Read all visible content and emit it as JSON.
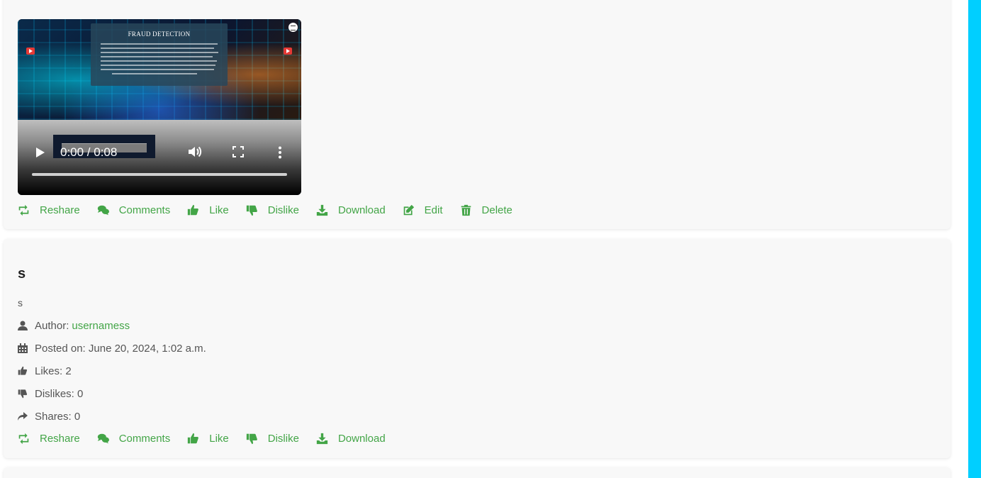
{
  "posts": [
    {
      "video": {
        "thumbnail_title": "FRAUD DETECTION",
        "time": "0:00 / 0:08",
        "played_fraction": 0
      },
      "actions": [
        "Reshare",
        "Comments",
        "Like",
        "Dislike",
        "Download",
        "Edit",
        "Delete"
      ]
    },
    {
      "title": "s",
      "body": "s",
      "author_label": "Author:",
      "author": "usernamess",
      "posted_on": "Posted on: June 20, 2024, 1:02 a.m.",
      "likes": "Likes: 2",
      "dislikes": "Dislikes: 0",
      "shares": "Shares: 0",
      "actions": [
        "Reshare",
        "Comments",
        "Like",
        "Dislike",
        "Download"
      ]
    }
  ],
  "colors": {
    "accent": "#43a547",
    "scrollbar": "#00cfff",
    "card_bg": "#f8f8f8",
    "text": "#555555"
  },
  "icons": [
    "retweet-icon",
    "comments-icon",
    "thumbs-up-icon",
    "thumbs-down-icon",
    "download-icon",
    "edit-icon",
    "trash-icon",
    "user-icon",
    "calendar-icon",
    "share-icon",
    "play-icon",
    "volume-icon",
    "fullscreen-icon",
    "more-vert-icon"
  ]
}
